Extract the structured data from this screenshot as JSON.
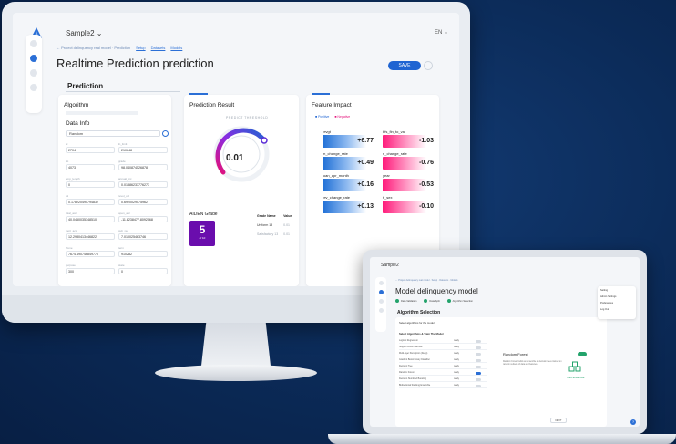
{
  "desktop": {
    "app_name": "Sample2 ⌄",
    "lang": "EN ⌄",
    "breadcrumb": [
      "← Project delinquency real model · Prediction",
      "Setup",
      "Datasets",
      "Models"
    ],
    "page_title": "Realtime Prediction prediction",
    "save_label": "SAVE",
    "section_title": "Prediction",
    "algorithm_title": "Algorithm",
    "data_info_title": "Data Info",
    "data_select_value": "Random",
    "fields": [
      {
        "label": "id",
        "value": "2704"
      },
      {
        "label": "ln_limit",
        "value": "210648"
      },
      {
        "label": "int",
        "value": "4073"
      },
      {
        "label": "grade",
        "value": "98.040874526878"
      },
      {
        "label": "emp_length",
        "value": "0"
      },
      {
        "label": "annual_inc",
        "value": "0.01386233776273"
      },
      {
        "label": "dti",
        "value": "0.178220495794832"
      },
      {
        "label": "revol_util",
        "value": "0.6920029075962"
      },
      {
        "label": "total_acc",
        "value": "40.0450035348510"
      },
      {
        "label": "open_acc",
        "value": "-11.8238477.8092068"
      },
      {
        "label": "mort_acc",
        "value": "12.2980413446822"
      },
      {
        "label": "pub_rec",
        "value": "7.010025463746"
      },
      {
        "label": "home",
        "value": "7674.490746849770"
      },
      {
        "label": "term",
        "value": "910282"
      },
      {
        "label": "purpose",
        "value": "300"
      },
      {
        "label": "state",
        "value": "0"
      }
    ],
    "prediction_result": {
      "title": "Prediction Result",
      "gauge_caption": "PREDICT THRESHOLD",
      "value": "0.01",
      "fraction": 0.01,
      "grade_title": "AIDEN Grade",
      "grade": "5",
      "grade_sub": "of 10",
      "grade_table": {
        "headers": [
          "Grade Name",
          "Value"
        ],
        "rows": [
          [
            "Uniform 13",
            "0.01"
          ],
          [
            "Satisfactory 13",
            "0.01"
          ]
        ]
      }
    },
    "feature_impact": {
      "title": "Feature Impact",
      "legend": [
        "■ Positive",
        "■ Negative"
      ],
      "positive": [
        {
          "name": "revgt",
          "value": "+6.77"
        },
        {
          "name": "m_change_rate",
          "value": "+0.49"
        },
        {
          "name": "loan_apr_month",
          "value": "+0.16"
        },
        {
          "name": "rev_change_rate",
          "value": "+0.13"
        }
      ],
      "negative": [
        {
          "name": "bfs_fin_to_val",
          "value": "-1.03"
        },
        {
          "name": "rl_change_rate",
          "value": "-0.76"
        },
        {
          "name": "year",
          "value": "-0.53"
        },
        {
          "name": "ti_sex",
          "value": "-0.10"
        }
      ]
    }
  },
  "laptop": {
    "app_name": "Sample2",
    "breadcrumb": "← Project delinquency real model · Setup · Datasets · Models",
    "page_title": "Model delinquency model",
    "steps": [
      "Data Validation",
      "Data Split",
      "Algorithm Selection"
    ],
    "section_title": "Algorithm Selection",
    "subtitle": "Select algorithms for the model",
    "list_title": "Select Algorithms & Train The Model",
    "algorithms": [
      {
        "name": "Logistic Regression",
        "status": "ready",
        "on": false
      },
      {
        "name": "Support Vector Machine",
        "status": "ready",
        "on": false
      },
      {
        "name": "Multi-layer Perceptron (Deep)",
        "status": "ready",
        "on": false
      },
      {
        "name": "Gradient Boost Binary Classifier",
        "status": "ready",
        "on": false
      },
      {
        "name": "Decision Tree",
        "status": "ready",
        "on": false
      },
      {
        "name": "Random Forest",
        "status": "ready",
        "on": true
      },
      {
        "name": "Decision Stumbled Boosting",
        "status": "ready",
        "on": false
      },
      {
        "name": "Bidirectional Stacking Ensemble",
        "status": "ready",
        "on": false
      }
    ],
    "rf_title": "Random Forest",
    "rf_text": "Random Forest builds an ensemble of decision trees trained on random subsets of data and features.",
    "train_label": "Train Ensemble",
    "next_label": "NEXT",
    "panel": [
      "Setting",
      "Admin Settings",
      "Preferences",
      "Log Out"
    ],
    "help": "?",
    "colors": {
      "accent": "#2b6fd6",
      "success": "#23a36b"
    }
  }
}
